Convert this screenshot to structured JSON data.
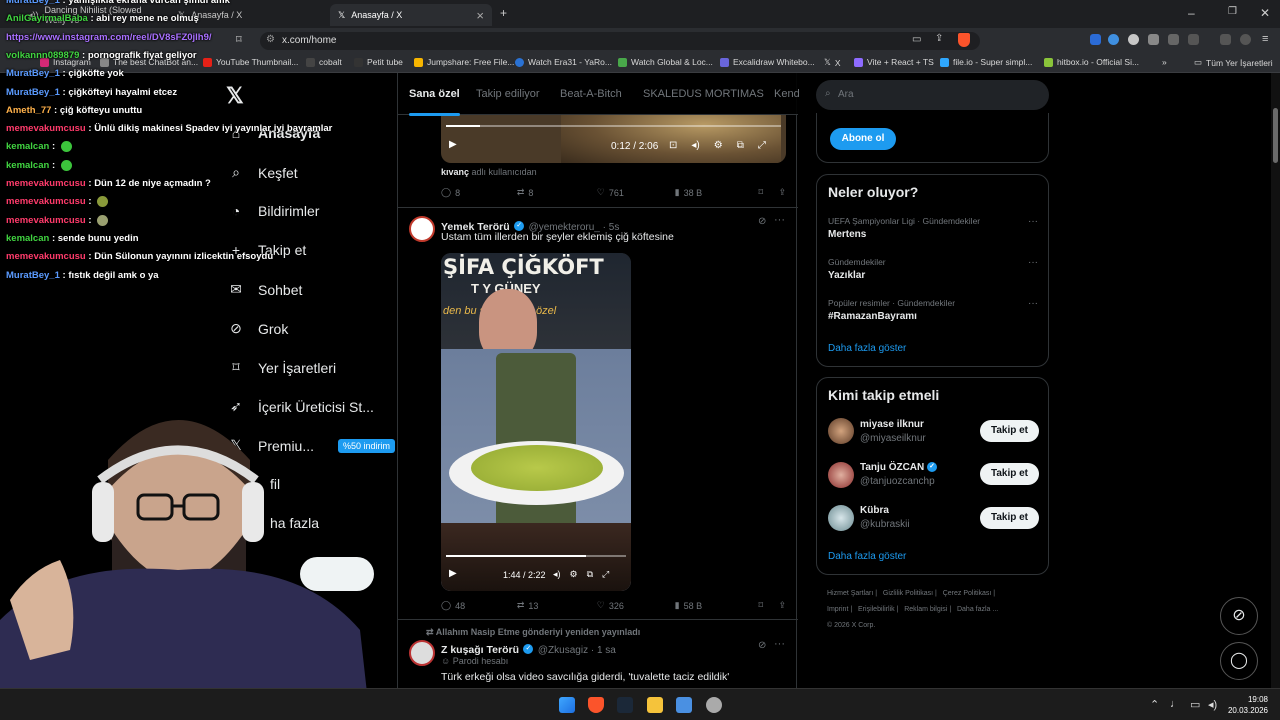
{
  "browser": {
    "tabs": [
      {
        "label": "Dancing Nihilist (Slowed Welly Vo"
      },
      {
        "label": "Anasayfa / X"
      },
      {
        "label": "Anasayfa / X"
      }
    ],
    "url": "x.com/home",
    "bookmarks": [
      "Instagram",
      "The best ChatBot an...",
      "YouTube Thumbnail...",
      "cobalt",
      "Petit tube",
      "Jumpshare: Free File...",
      "Watch Era31 - YaRo...",
      "Watch Global & Loc...",
      "Excalidraw Whitebo...",
      "X",
      "Vite + React + TS",
      "file.io - Super simpl...",
      "hitbox.io - Official Si..."
    ],
    "all_bookmarks": "Tüm Yer İşaretleri"
  },
  "nav": {
    "items": [
      {
        "label": "Anasayfa"
      },
      {
        "label": "Keşfet"
      },
      {
        "label": "Bildirimler"
      },
      {
        "label": "Takip et"
      },
      {
        "label": "Sohbet"
      },
      {
        "label": "Grok"
      },
      {
        "label": "Yer İşaretleri"
      },
      {
        "label": "İçerik Üreticisi St..."
      },
      {
        "label": "Premiu..."
      },
      {
        "label": "fil"
      },
      {
        "label": "ha fazla"
      }
    ],
    "premium_badge": "%50 indirim"
  },
  "feed": {
    "tabs": [
      "Sana özel",
      "Takip ediliyor",
      "Beat-A-Bitch",
      "SKALEDUS MORTIMAS",
      "Kend"
    ],
    "video1": {
      "time": "0:12 / 2:06",
      "progress": 0.1
    },
    "prev_by": "kıvanç",
    "prev_by_suffix": "adlı kullanıcıdan",
    "prev_actions": {
      "replies": "8",
      "reposts": "8",
      "likes": "761",
      "views": "38 B"
    },
    "tweet1": {
      "name": "Yemek Terörü",
      "handle": "@yemekteroru_ · 5s",
      "text": "Ustam tüm illerden bir şeyler eklemiş çiğ köftesine",
      "video_sign_line1": "ŞİFA ÇİĞKÖFT",
      "video_sign_line2": "T  Y GÜNEY",
      "video_sign_line3": "den bu   şube, butik özel",
      "video_time": "1:44 / 2:22",
      "video_progress": 0.78,
      "actions": {
        "replies": "48",
        "reposts": "13",
        "likes": "326",
        "views": "58 B"
      }
    },
    "tweet2": {
      "repost_note": "Allahım Nasip Etme gönderiyi yeniden yayınladı",
      "name": "Z kuşağı Terörü",
      "handle": "@Zkusagiz · 1 sa",
      "parody": "Parodi hesabı",
      "text": "Türk erkeği olsa video savcılığa giderdi, 'tuvalette taciz edildik'"
    }
  },
  "right": {
    "search_placeholder": "Ara",
    "subscribe_label": "Abone ol",
    "trending_title": "Neler oluyor?",
    "trends": [
      {
        "meta": "UEFA Şampiyonlar Ligi · Gündemdekiler",
        "name": "Mertens"
      },
      {
        "meta": "Gündemdekiler",
        "name": "Yazıklar"
      },
      {
        "meta": "Popüler resimler · Gündemdekiler",
        "name": "#RamazanBayramı"
      }
    ],
    "show_more": "Daha fazla göster",
    "who_title": "Kimi takip etmeli",
    "who": [
      {
        "name": "miyase ilknur",
        "handle": "@miyaseilknur",
        "button": "Takip et",
        "verified": false
      },
      {
        "name": "Tanju ÖZCAN",
        "handle": "@tanjuozcanchp",
        "button": "Takip et",
        "verified": true
      },
      {
        "name": "Kübra",
        "handle": "@kubraskii",
        "button": "Takip et",
        "verified": false
      }
    ],
    "who_show_more": "Daha fazla göster",
    "footer": [
      "Hizmet Şartları",
      "Gizlilik Politikası",
      "Çerez Politikası",
      "Imprint",
      "Erişilebilirlik",
      "Reklam bilgisi",
      "Daha fazla ...",
      "© 2026 X Corp."
    ]
  },
  "chat": [
    {
      "user": "MuratBey_1",
      "color": "#5b9bff",
      "msg": "yanlışlıkla ekrana vurcan şimdi amk"
    },
    {
      "user": "AnilGayirmalBaba",
      "color": "#41d441",
      "msg": "abi rey mene ne olmuş"
    },
    {
      "user": "",
      "color": "#a970ff",
      "msg": "https://www.instagram.com/reel/DV8sFZ0jlh9/"
    },
    {
      "user": "volkannn089879",
      "color": "#41d441",
      "msg": "pornografik fiyat geliyor"
    },
    {
      "user": "MuratBey_1",
      "color": "#5b9bff",
      "msg": "çiğköfte yok"
    },
    {
      "user": "MuratBey_1",
      "color": "#5b9bff",
      "msg": "çiğköfteyi hayalmi etcez"
    },
    {
      "user": "Ameth_77",
      "color": "#ffb14a",
      "msg": "çiğ köfteyu unuttu"
    },
    {
      "user": "memevakumcusu",
      "color": "#ff3b6b",
      "msg": "Ünlü dikiş makinesi Spadev iyi yayınlar iyi bayramlar"
    },
    {
      "user": "kemalcan",
      "color": "#41d441",
      "msg": "",
      "emote": "#3cc43c"
    },
    {
      "user": "kemalcan",
      "color": "#41d441",
      "msg": "",
      "emote": "#3cc43c"
    },
    {
      "user": "memevakumcusu",
      "color": "#ff3b6b",
      "msg": "Dün 12 de niye açmadın ?"
    },
    {
      "user": "memevakumcusu",
      "color": "#ff3b6b",
      "msg": "",
      "emote": "#8a9a3a"
    },
    {
      "user": "memevakumcusu",
      "color": "#ff3b6b",
      "msg": "",
      "emote": "#9aa070"
    },
    {
      "user": "kemalcan",
      "color": "#41d441",
      "msg": "sende bunu yedin"
    },
    {
      "user": "memevakumcusu",
      "color": "#ff3b6b",
      "msg": "Dün Sülonun yayınını izlicektin efsoydu"
    },
    {
      "user": "MuratBey_1",
      "color": "#5b9bff",
      "msg": "fıstık değil amk o ya"
    }
  ],
  "taskbar": {
    "time": "19:08",
    "date": "20.03.2026"
  },
  "colors": {
    "accent": "#1d9bf0",
    "bg": "#000000",
    "border": "#2f3336",
    "muted": "#71767b"
  }
}
